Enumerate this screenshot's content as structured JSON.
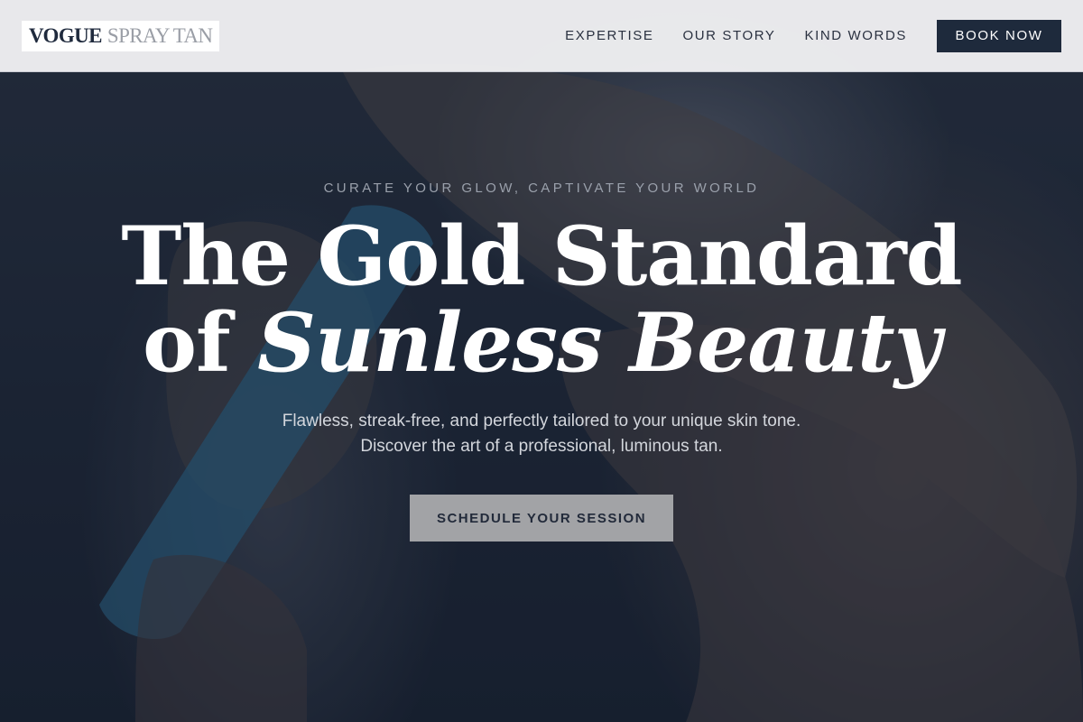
{
  "brand": {
    "name_primary": "VOGUE",
    "name_secondary": "SPRAY TAN"
  },
  "nav": {
    "links": [
      {
        "label": "EXPERTISE"
      },
      {
        "label": "OUR STORY"
      },
      {
        "label": "KIND WORDS"
      }
    ],
    "book_button": "BOOK NOW"
  },
  "hero": {
    "eyebrow": "CURATE YOUR GLOW, CAPTIVATE YOUR WORLD",
    "headline_line1": "The Gold Standard",
    "headline_line2_plain": "of",
    "headline_line2_italic": "Sunless Beauty",
    "subtext_line1": "Flawless, streak-free, and perfectly tailored to your unique skin tone.",
    "subtext_line2": "Discover the art of a professional, luminous tan.",
    "cta_label": "SCHEDULE YOUR SESSION",
    "background_image": "spray-tan-application-photo"
  },
  "colors": {
    "navy": "#1e2a3c",
    "nav_bg": "#f0f0f3",
    "cta_bg": "#a2a3a6",
    "headline": "#ffffff",
    "eyebrow": "#9aa0ab"
  }
}
